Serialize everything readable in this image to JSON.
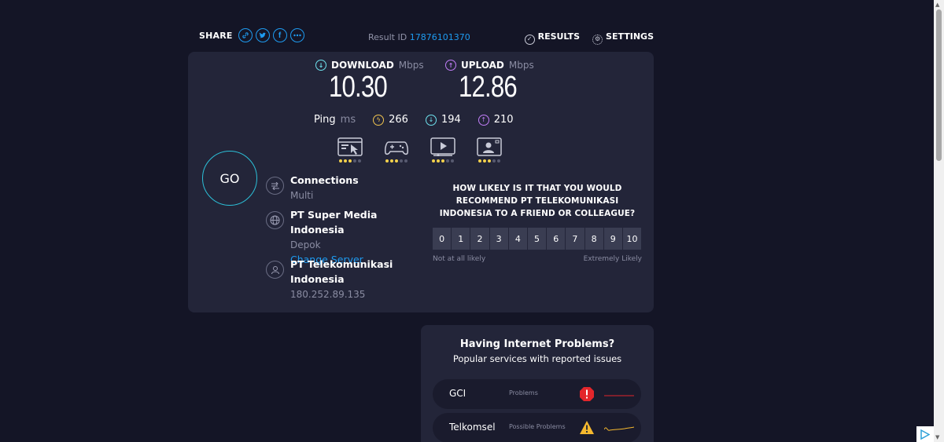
{
  "header": {
    "share_label": "SHARE",
    "result_id_label": "Result ID",
    "result_id_value": "17876101370",
    "results_label": "RESULTS",
    "settings_label": "SETTINGS"
  },
  "download": {
    "label": "DOWNLOAD",
    "unit": "Mbps",
    "value": "10.30"
  },
  "upload": {
    "label": "UPLOAD",
    "unit": "Mbps",
    "value": "12.86"
  },
  "ping": {
    "label": "Ping",
    "unit": "ms",
    "idle": "266",
    "download": "194",
    "upload": "210"
  },
  "usecases": [
    {
      "icon": "web-browsing-icon",
      "rating": 3
    },
    {
      "icon": "gaming-icon",
      "rating": 3
    },
    {
      "icon": "video-streaming-icon",
      "rating": 3
    },
    {
      "icon": "video-chat-icon",
      "rating": 3
    }
  ],
  "go_label": "GO",
  "connections": {
    "title": "Connections",
    "value": "Multi"
  },
  "server": {
    "name": "PT Super Media Indonesia",
    "location": "Depok",
    "change_label": "Change Server"
  },
  "isp": {
    "name": "PT Telekomunikasi Indonesia",
    "ip": "180.252.89.135"
  },
  "survey": {
    "question": "HOW LIKELY IS IT THAT YOU WOULD RECOMMEND PT TELEKOMUNIKASI INDONESIA TO A FRIEND OR COLLEAGUE?",
    "scale": [
      "0",
      "1",
      "2",
      "3",
      "4",
      "5",
      "6",
      "7",
      "8",
      "9",
      "10"
    ],
    "low_label": "Not at all likely",
    "high_label": "Extremely Likely"
  },
  "problems": {
    "title": "Having Internet Problems?",
    "subtitle": "Popular services with reported issues",
    "items": [
      {
        "name": "GCI",
        "status": "Problems",
        "icon": "alert-icon",
        "color": "#e3262b"
      },
      {
        "name": "Telkomsel",
        "status": "Possible Problems",
        "icon": "warning-icon",
        "color": "#f5b82e"
      }
    ]
  },
  "colors": {
    "accent": "#1e9bf0",
    "download": "#6fe3ef",
    "upload": "#c27ef9",
    "ping": "#f1c54f",
    "go_ring": "#2cc0d8"
  }
}
